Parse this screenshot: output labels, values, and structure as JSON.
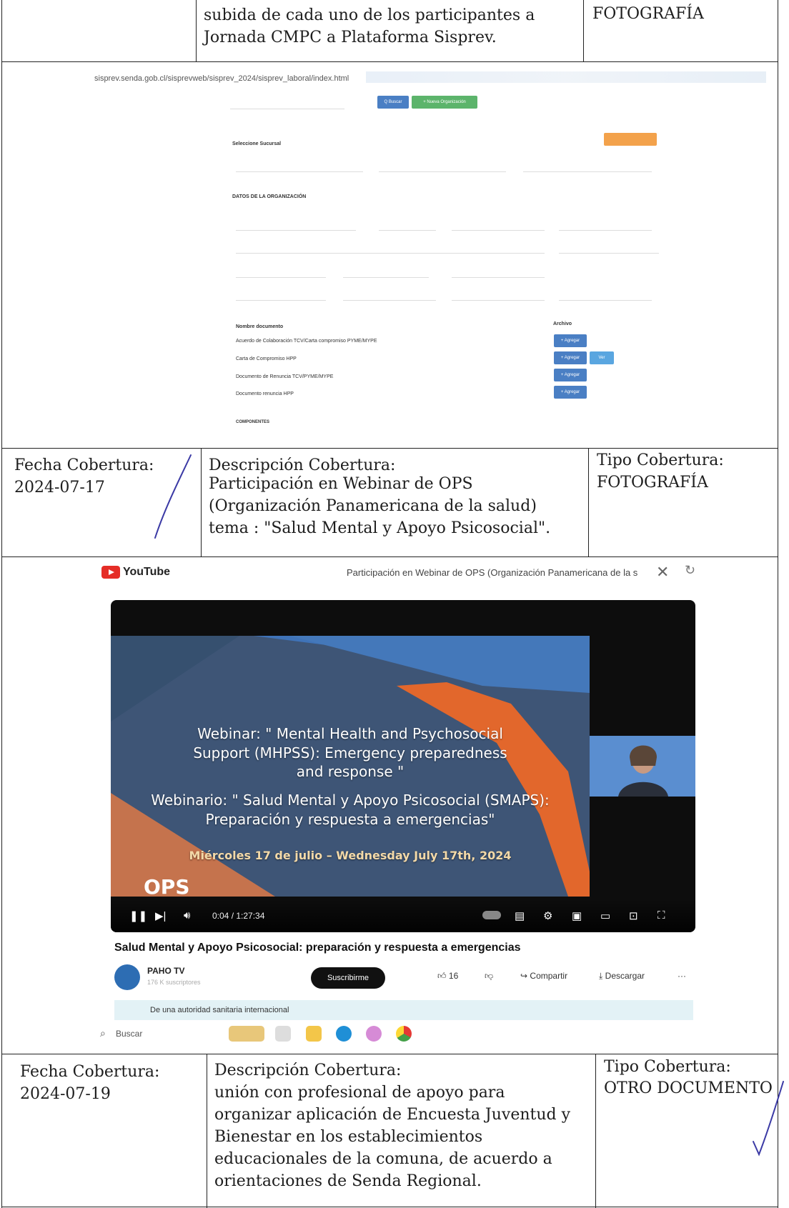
{
  "row1": {
    "description": "subida de cada uno de los participantes a Jornada CMPC a Plataforma Sisprev.",
    "type_value": "FOTOGRAFÍA"
  },
  "screenshot1": {
    "url": "sisprev.senda.gob.cl/sisprevweb/sisprev_2024/sisprev_laboral/index.html",
    "search_button": "Q Buscar",
    "new_org_button": "+ Nueva Organización",
    "sucursal_title": "Seleccione Sucursal",
    "org_data_title": "DATOS DE LA ORGANIZACIÓN",
    "doc_name_header": "Nombre documento",
    "archivo_header": "Archivo",
    "documents": [
      "Acuerdo de Colaboración TCV/Carta compromiso PYME/MYPE",
      "Carta de Compromiso HPP",
      "Documento de Renuncia TCV/PYME/MYPE",
      "Documento renuncia HPP"
    ],
    "add_button": "+ Agregar",
    "view_button": "Ver",
    "componentes": "COMPONENTES"
  },
  "row2": {
    "date_label": "Fecha Cobertura:",
    "date_value": "2024-07-17",
    "desc_label": "Descripción Cobertura:",
    "desc_value": "Participación en Webinar de OPS (Organización Panamericana de la salud) tema : \"Salud Mental y Apoyo Psicosocial\".",
    "type_label": "Tipo Cobertura:",
    "type_value": "FOTOGRAFÍA"
  },
  "screenshot2": {
    "logo": "YouTube",
    "window_title": "Participación en Webinar de OPS (Organización Panamericana de la s",
    "slide_lines": [
      "Webinar: \" Mental Health and Psychosocial",
      "Support (MHPSS): Emergency preparedness",
      "and response \"",
      "Webinario: \" Salud Mental y Apoyo Psicosocial (SMAPS):",
      "Preparación y respuesta a emergencias\"",
      "Miércoles 17 de julio – Wednesday July 17th, 2024"
    ],
    "ops_logo": "OPS",
    "time": "0:04 / 1:27:34",
    "video_title": "Salud Mental y Apoyo Psicosocial: preparación y respuesta a emergencias",
    "channel_name": "PAHO TV",
    "subscribers": "176 K suscriptores",
    "subscribe_button": "Suscribirme",
    "likes": "16",
    "share": "Compartir",
    "download": "Descargar",
    "more": "···",
    "description_snippet": "De una autoridad sanitaria internacional",
    "search": "Buscar"
  },
  "row3": {
    "date_label": "Fecha Cobertura:",
    "date_value": "2024-07-19",
    "desc_label": "Descripción Cobertura:",
    "desc_value": "unión con profesional de apoyo para organizar aplicación de Encuesta Juventud y Bienestar en los establecimientos educacionales de la comuna, de acuerdo a orientaciones de Senda Regional.",
    "type_label": "Tipo Cobertura:",
    "type_value": "OTRO DOCUMENTO"
  }
}
